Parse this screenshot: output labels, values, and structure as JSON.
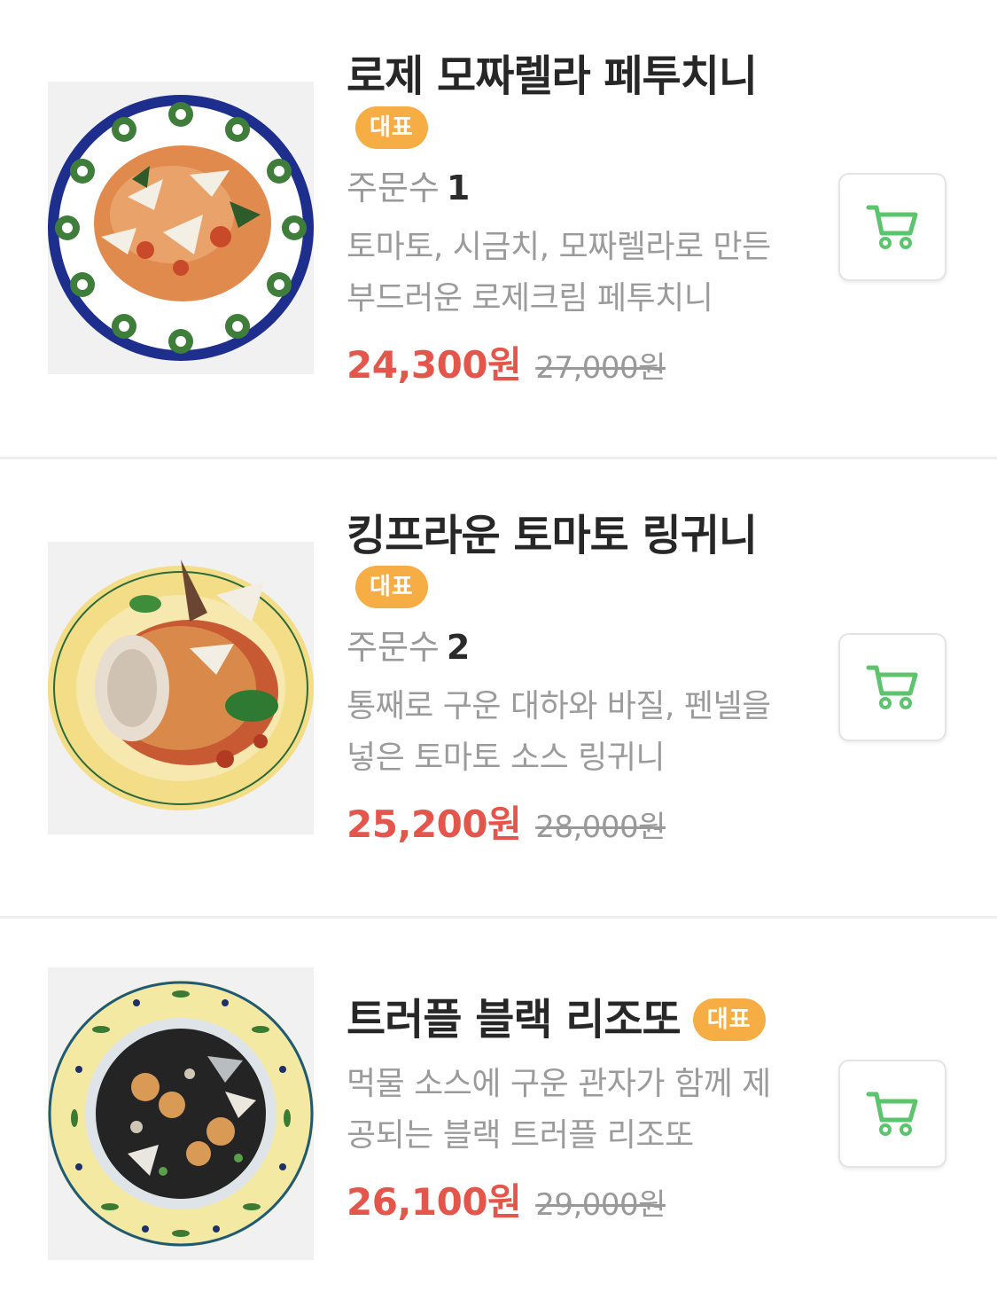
{
  "accent_colors": {
    "price": "#e4564b",
    "badge": "#f6ad44",
    "cart_icon": "#5bc46d"
  },
  "menu_items": [
    {
      "name": "로제 모짜렐라 페투치니",
      "badge": "대표",
      "orders_label": "주문수",
      "orders_count": "1",
      "description": "토마토, 시금치, 모짜렐라로 만든 부드러운 로제크림 페투치니",
      "price": "24,300원",
      "original_price": "27,000원",
      "image_icon": "rose-pasta-dish-photo",
      "cart_icon": "shopping-cart-icon"
    },
    {
      "name": "킹프라운 토마토 링귀니",
      "badge": "대표",
      "orders_label": "주문수",
      "orders_count": "2",
      "description": "통째로 구운 대하와 바질, 펜넬을 넣은 토마토 소스 링귀니",
      "price": "25,200원",
      "original_price": "28,000원",
      "image_icon": "prawn-linguine-dish-photo",
      "cart_icon": "shopping-cart-icon"
    },
    {
      "name": "트러플 블랙 리조또",
      "badge": "대표",
      "description": "먹물 소스에 구운 관자가 함께 제공되는 블랙 트러플 리조또",
      "price": "26,100원",
      "original_price": "29,000원",
      "image_icon": "black-risotto-dish-photo",
      "cart_icon": "shopping-cart-icon"
    }
  ]
}
